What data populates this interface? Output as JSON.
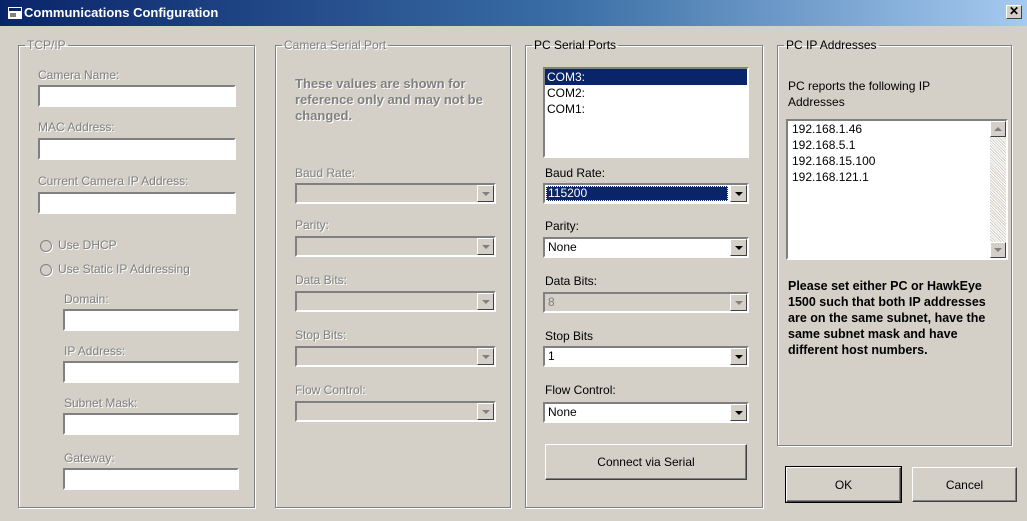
{
  "window": {
    "title": "Communications Configuration",
    "close_glyph": "✕"
  },
  "tcpip": {
    "legend": "TCP/IP",
    "camera_name_label": "Camera Name:",
    "mac_label": "MAC Address:",
    "current_ip_label": "Current Camera IP Address:",
    "use_dhcp_label": "Use DHCP",
    "use_static_label": "Use Static IP Addressing",
    "domain_label": "Domain:",
    "ip_label": "IP Address:",
    "subnet_label": "Subnet Mask:",
    "gateway_label": "Gateway:"
  },
  "camera_serial": {
    "legend": "Camera Serial Port",
    "note": "These values are shown for reference only and may not be changed.",
    "baud_label": "Baud Rate:",
    "parity_label": "Parity:",
    "databits_label": "Data Bits:",
    "stopbits_label": "Stop Bits:",
    "flow_label": "Flow Control:"
  },
  "pc_serial": {
    "legend": "PC Serial Ports",
    "ports": [
      "COM3:",
      "COM2:",
      "COM1:"
    ],
    "selected_port": "COM3:",
    "baud_label": "Baud Rate:",
    "baud_value": "115200",
    "parity_label": "Parity:",
    "parity_value": "None",
    "databits_label": "Data Bits:",
    "databits_value": "8",
    "stopbits_label": "Stop Bits",
    "stopbits_value": "1",
    "flow_label": "Flow Control:",
    "flow_value": "None",
    "connect_label": "Connect via Serial"
  },
  "pc_ip": {
    "legend": "PC IP Addresses",
    "intro": "PC reports the following IP Addresses",
    "addresses": [
      "192.168.1.46",
      "192.168.5.1",
      "192.168.15.100",
      "192.168.121.1"
    ],
    "note": "Please set either PC or HawkEye 1500 such that both IP addresses are on the same subnet, have the same subnet mask and have different host numbers."
  },
  "buttons": {
    "ok": "OK",
    "cancel": "Cancel"
  },
  "colors": {
    "titlebar": "#0a246a",
    "face": "#d4d0c8",
    "selection": "#0a246a"
  },
  "icons": {
    "app": "app-window-icon",
    "close": "close-icon"
  }
}
